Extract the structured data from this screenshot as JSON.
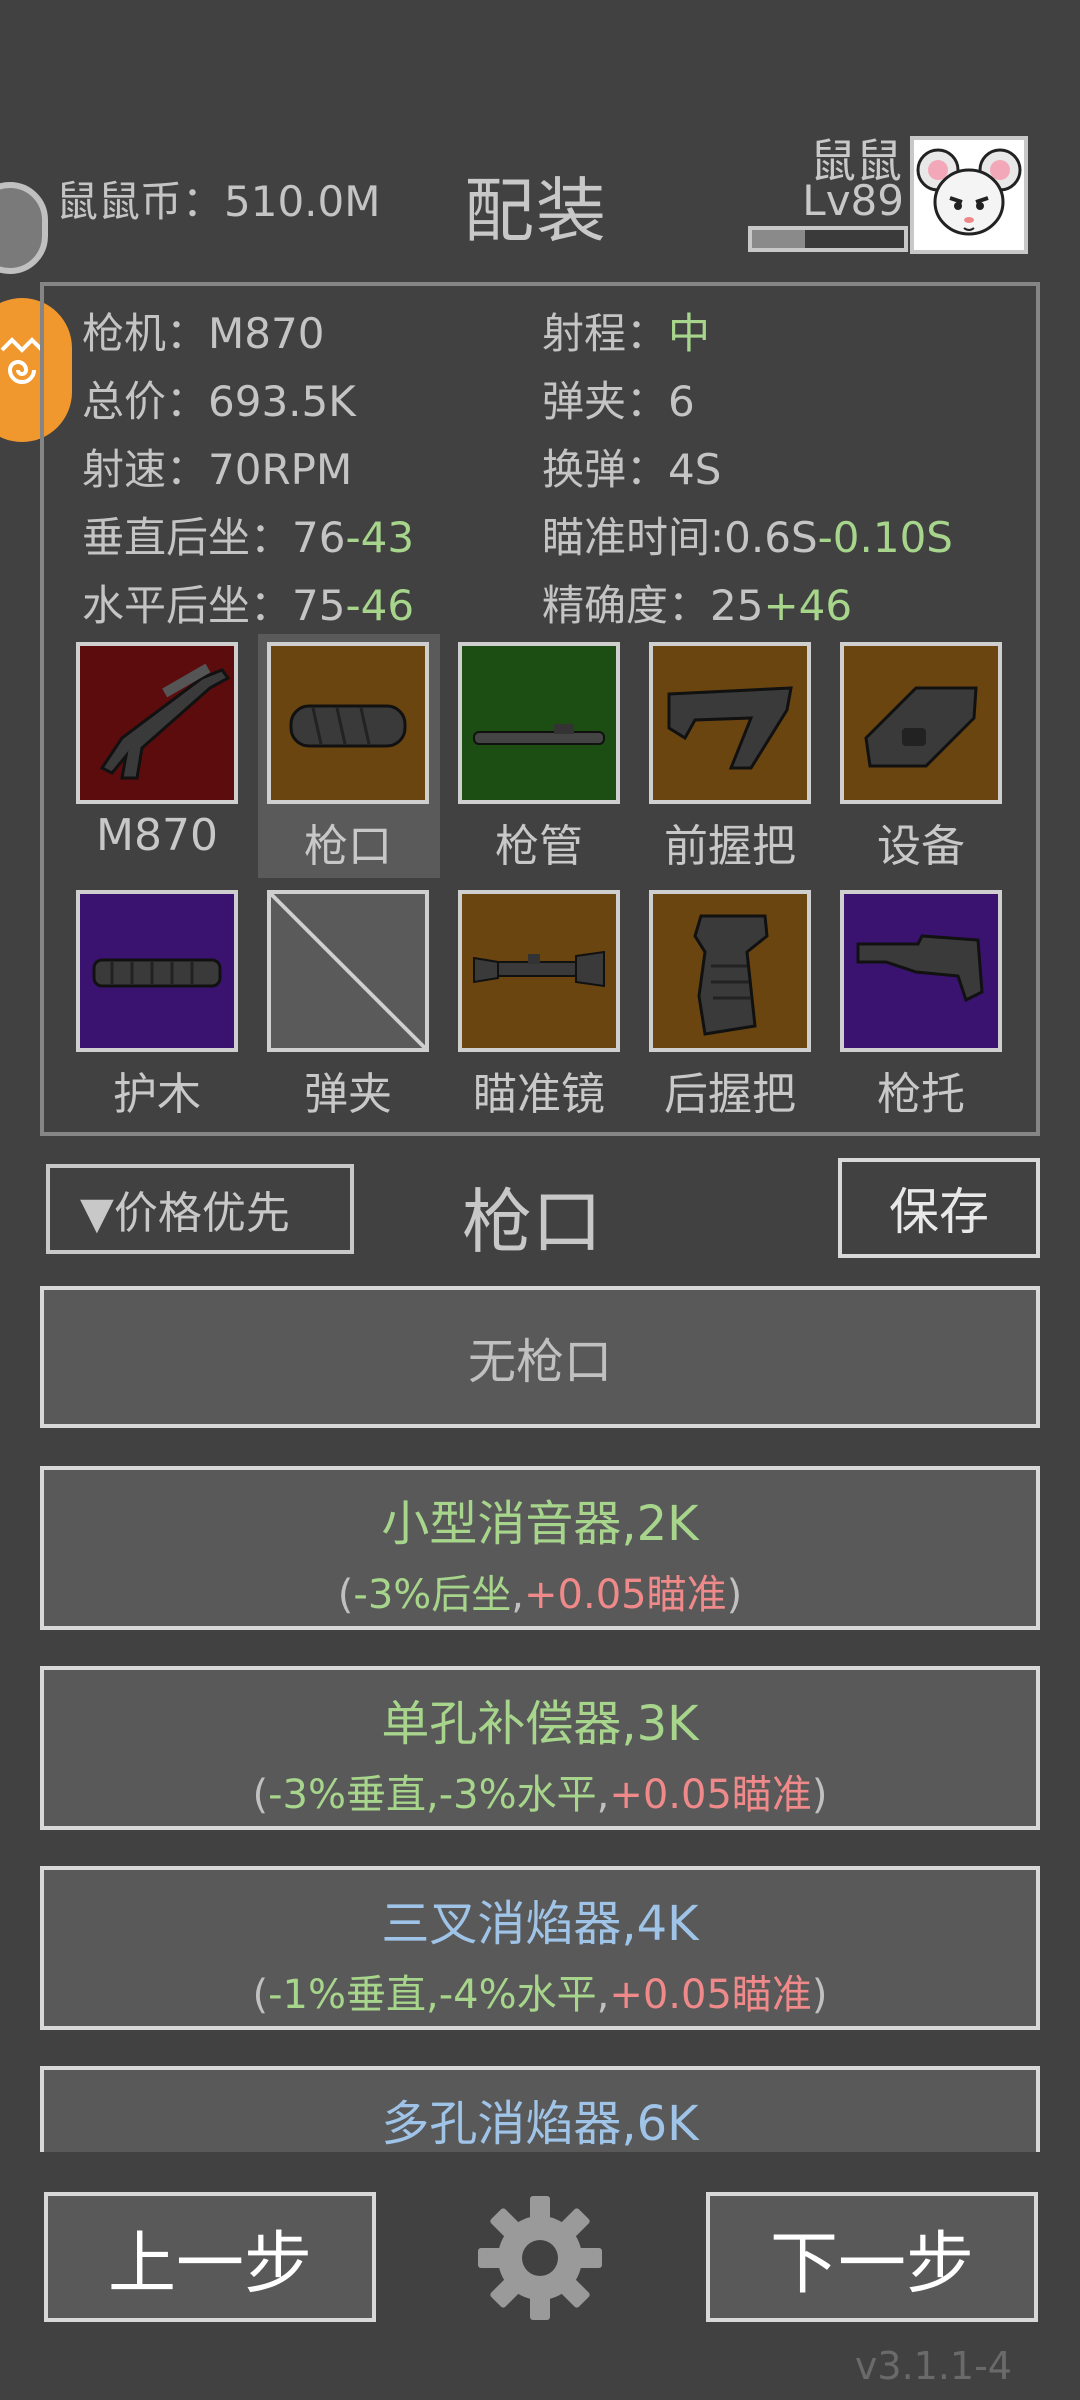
{
  "header": {
    "coin_label": "鼠鼠币：510.0M",
    "title": "配装",
    "user_name": "鼠鼠",
    "user_level": "Lv89",
    "xp_progress": 0.35
  },
  "stats": {
    "gun_label": "枪机：",
    "gun_value": "M870",
    "range_label": "射程：",
    "range_value": "中",
    "price_label": "总价：",
    "price_value": "693.5K",
    "mag_label": "弹夹：",
    "mag_value": "6",
    "rate_label": "射速：",
    "rate_value": "70RPM",
    "reload_label": "换弹：",
    "reload_value": "4S",
    "vrecoil_label": "垂直后坐：",
    "vrecoil_base": "76",
    "vrecoil_mod": "-43",
    "aim_label": "瞄准时间:",
    "aim_base": "0.6S",
    "aim_mod": "-0.10S",
    "hrecoil_label": "水平后坐：",
    "hrecoil_base": "75",
    "hrecoil_mod": "-46",
    "accuracy_label": "精确度：",
    "accuracy_base": "25",
    "accuracy_mod": "+46"
  },
  "slots": [
    {
      "label": "M870",
      "bg": "#5c0c0c",
      "icon": "shotgun-icon"
    },
    {
      "label": "枪口",
      "bg": "#6a4510",
      "icon": "suppressor-icon"
    },
    {
      "label": "枪管",
      "bg": "#1c4d12",
      "icon": "barrel-icon"
    },
    {
      "label": "前握把",
      "bg": "#6a4510",
      "icon": "foregrip-icon"
    },
    {
      "label": "设备",
      "bg": "#6a4510",
      "icon": "device-icon"
    },
    {
      "label": "护木",
      "bg": "#3a1370",
      "icon": "handguard-icon"
    },
    {
      "label": "弹夹",
      "bg": "#5a5a5a",
      "icon": "empty-slot-icon"
    },
    {
      "label": "瞄准镜",
      "bg": "#6a4510",
      "icon": "scope-icon"
    },
    {
      "label": "后握把",
      "bg": "#6a4510",
      "icon": "pistol-grip-icon"
    },
    {
      "label": "枪托",
      "bg": "#3a1370",
      "icon": "stock-icon"
    }
  ],
  "sort_button": "▼价格优先",
  "section_title": "枪口",
  "save_button": "保存",
  "options": {
    "none": "无枪口",
    "o1_name": "小型消音器,2K",
    "o1_p1": "(",
    "o1_p2": "-3%后坐",
    "o1_p3": ",",
    "o1_p4": "+0.05瞄准",
    "o1_p5": ")",
    "o2_name": "单孔补偿器,3K",
    "o2_p1": "(",
    "o2_p2": "-3%垂直,-3%水平",
    "o2_p3": ",",
    "o2_p4": "+0.05瞄准",
    "o2_p5": ")",
    "o3_name": "三叉消焰器,4K",
    "o3_p1": "(",
    "o3_p2": "-1%垂直,-4%水平",
    "o3_p3": ",",
    "o3_p4": "+0.05瞄准",
    "o3_p5": ")",
    "o4_name": "多孔消焰器,6K"
  },
  "footer": {
    "prev": "上一步",
    "next": "下一步",
    "version": "v3.1.1-4"
  },
  "colors": {
    "background": "#414141",
    "positive": "#a6d58b",
    "negative": "#f08a8a",
    "rare": "#9fc4e8"
  }
}
